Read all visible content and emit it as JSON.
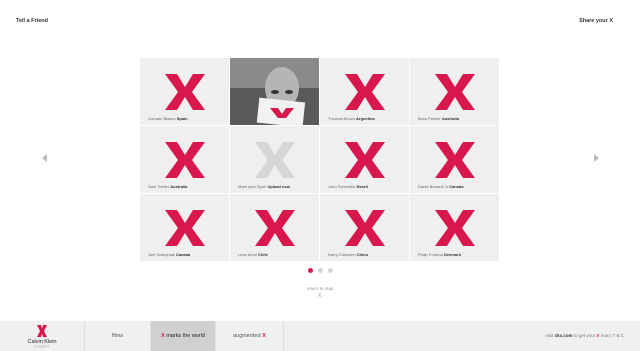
{
  "header": {
    "tell_friend": "Tell a Friend",
    "share": "Share your X"
  },
  "brand": {
    "accent": "#d8174d",
    "name": "Calvin Klein",
    "sub": "CONCEPT"
  },
  "tiles": [
    {
      "name": "Corrado Blasco",
      "place": "Spain",
      "mark": "red-x"
    },
    {
      "name": "",
      "place": "",
      "mark": "photo"
    },
    {
      "name": "Thomas Brown",
      "place": "Argentina",
      "mark": "red-x"
    },
    {
      "name": "Buck Palmer",
      "place": "Australia",
      "mark": "red-x"
    },
    {
      "name": "Sam Tichler",
      "place": "Australia",
      "mark": "red-x"
    },
    {
      "name": "Mark your Spot:",
      "place": "Upload now",
      "mark": "gray-x"
    },
    {
      "name": "John Schneider",
      "place": "Brazil",
      "mark": "red-x"
    },
    {
      "name": "Dante Benardi Jr",
      "place": "Canada",
      "mark": "red-x"
    },
    {
      "name": "Joel Gabryniak",
      "place": "Canada",
      "mark": "red-x"
    },
    {
      "name": "Lenz Arbol",
      "place": "Chile",
      "mark": "red-x"
    },
    {
      "name": "Harry Chisholm",
      "place": "China",
      "mark": "red-x"
    },
    {
      "name": "Philip Fortuna",
      "place": "Denmark",
      "mark": "red-x"
    }
  ],
  "pagination": {
    "pages": 3,
    "current": 1
  },
  "return_link": "return to map",
  "return_x": "X",
  "footer": {
    "tab_films": "films",
    "tab_marks_x": "X",
    "tab_marks": "marks the world",
    "tab_aug": "augmented",
    "tab_aug_x": "X",
    "visit_prefix": "visit",
    "site": "ckx.com",
    "visit_mid": "to get your",
    "visit_x": "X",
    "now": "now",
    "sep": "|",
    "tc": "T & C"
  }
}
